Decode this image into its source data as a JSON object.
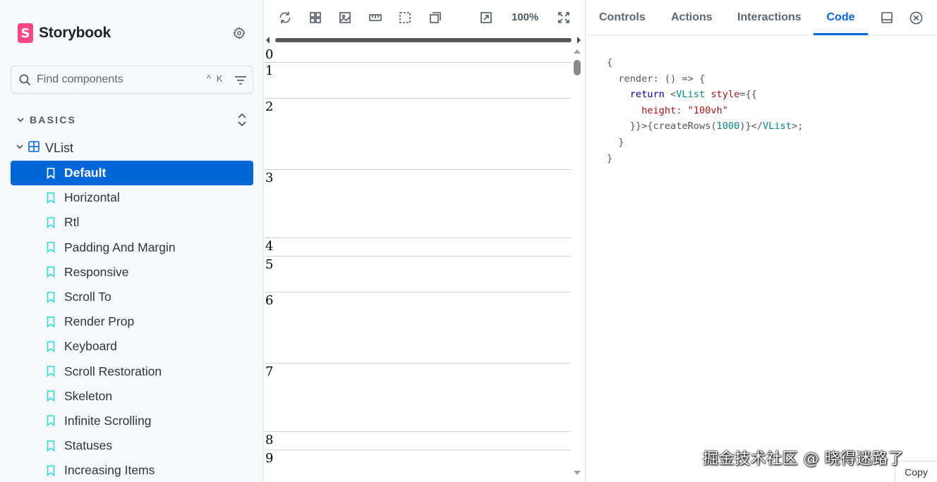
{
  "sidebar": {
    "brand_initial": "S",
    "brand_name": "Storybook",
    "search": {
      "placeholder": "Find components",
      "shortcut": "^ K"
    },
    "group_label": "BASICS",
    "component_label": "VList",
    "stories": [
      {
        "label": "Default",
        "selected": true
      },
      {
        "label": "Horizontal"
      },
      {
        "label": "Rtl"
      },
      {
        "label": "Padding And Margin"
      },
      {
        "label": "Responsive"
      },
      {
        "label": "Scroll To"
      },
      {
        "label": "Render Prop"
      },
      {
        "label": "Keyboard"
      },
      {
        "label": "Scroll Restoration"
      },
      {
        "label": "Skeleton"
      },
      {
        "label": "Infinite Scrolling"
      },
      {
        "label": "Statuses"
      },
      {
        "label": "Increasing Items"
      }
    ]
  },
  "toolbar": {
    "zoom": "100%"
  },
  "canvas": {
    "rows": [
      "0",
      "1",
      "2",
      "3",
      "4",
      "5",
      "6",
      "7",
      "8",
      "9"
    ]
  },
  "panel": {
    "tabs": [
      "Controls",
      "Actions",
      "Interactions",
      "Code"
    ],
    "active_tab": "Code",
    "copy_label": "Copy"
  },
  "watermark": "掘金技术社区 @ 晓得迷路了",
  "colors": {
    "accent": "#0366d6",
    "brand": "#ff4785",
    "story_icon": "#37d5d3"
  }
}
